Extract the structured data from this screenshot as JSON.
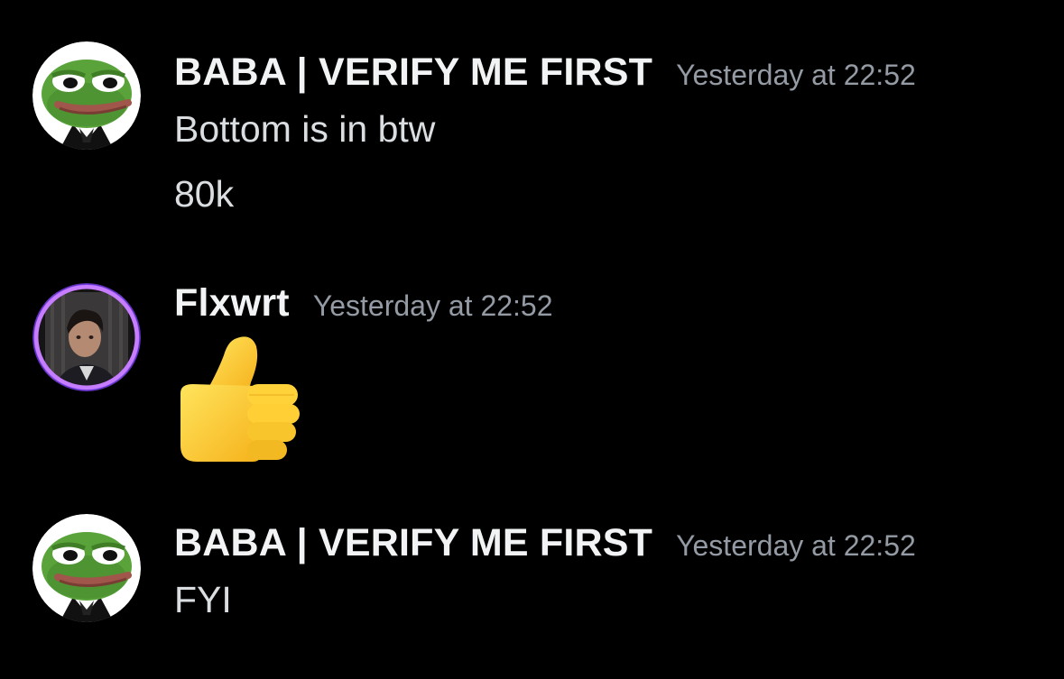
{
  "messages": [
    {
      "author": "BABA | VERIFY ME FIRST",
      "timestamp": "Yesterday at 22:52",
      "avatar_icon": "pepe-frog-avatar",
      "lines": [
        "Bottom is in btw",
        "80k"
      ]
    },
    {
      "author": "Flxwrt",
      "timestamp": "Yesterday at 22:52",
      "avatar_icon": "profile-photo-avatar",
      "avatar_ring_color": "#b26bff",
      "emoji": "thumbs-up"
    },
    {
      "author": "BABA | VERIFY ME FIRST",
      "timestamp": "Yesterday at 22:52",
      "avatar_icon": "pepe-frog-avatar",
      "lines": [
        "FYI"
      ]
    }
  ],
  "colors": {
    "background": "#000000",
    "username": "#f2f3f5",
    "timestamp": "#949ba4",
    "message_text": "#dbdee1"
  }
}
